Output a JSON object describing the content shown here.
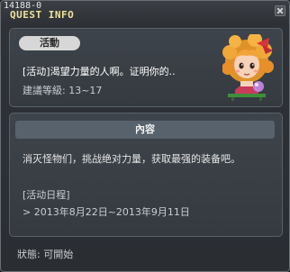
{
  "window": {
    "id": "14188-0",
    "title": "QUEST INFO"
  },
  "quest": {
    "category": "活動",
    "name": "[活动]渴望力量的人啊。证明你的..",
    "level_label": "建議等級: 13~17"
  },
  "content": {
    "header": "內容",
    "description": "消灭怪物们，挑战绝对力量，获取最强的装备吧。",
    "schedule_label": "[活动日程]",
    "schedule": "> 2013年8月22日~2013年9月11日"
  },
  "status": {
    "text": "狀態: 可開始"
  }
}
